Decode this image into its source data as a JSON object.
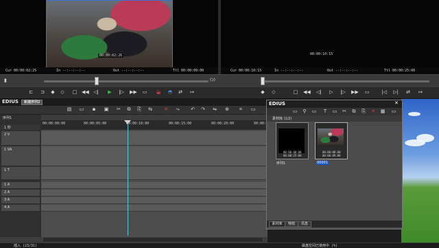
{
  "player": {
    "overlay_tc": "00:00:02:26",
    "cur": "Cur 00:00:02:25",
    "in": "In --:--:--:--",
    "out": "Out --:--:--:--",
    "ttl": "Ttl 00:00:09:00"
  },
  "recorder": {
    "overlay_tc": "00:00:10:15",
    "cur": "Cur 00:00:10:15",
    "in": "In --:--:--:--",
    "out": "Out --:--:--:--",
    "ttl": "Ttl 00:00:25:00"
  },
  "app": {
    "name": "EDIUS",
    "sequence_tab": "新建序列2"
  },
  "timeline": {
    "sequence_label": "序列1",
    "ruler_marks": [
      "00:00:00:00",
      "00:00:05:00",
      "00:00:10:00",
      "00:00:15:00",
      "00:00:20:00",
      "00:00:25"
    ],
    "tracks": [
      {
        "label": "1 秒",
        "kind": "zoom"
      },
      {
        "label": "2 V",
        "kind": "video"
      },
      {
        "label": "1 VA",
        "kind": "videoaudio"
      },
      {
        "label": "1 T",
        "kind": "title"
      },
      {
        "label": "1 A",
        "kind": "audio"
      },
      {
        "label": "2 A",
        "kind": "audio"
      },
      {
        "label": "3 A",
        "kind": "audio"
      },
      {
        "label": "4 A",
        "kind": "audio"
      }
    ]
  },
  "bin": {
    "title": "EDIUS",
    "folder": "素材库 (1/2)",
    "clips": [
      {
        "name": "序列1",
        "tc": "00:00:00:00",
        "dur": "00:00:25:00",
        "selected": false
      },
      {
        "name": "00001",
        "tc": "00:00:00:00",
        "dur": "00:00:09:00",
        "selected": true
      }
    ],
    "tabs": [
      "素材库",
      "特效",
      "讯息"
    ]
  },
  "status": {
    "left": "插入 (23/31)",
    "right": "磁盘空间已使用中 (%)"
  }
}
